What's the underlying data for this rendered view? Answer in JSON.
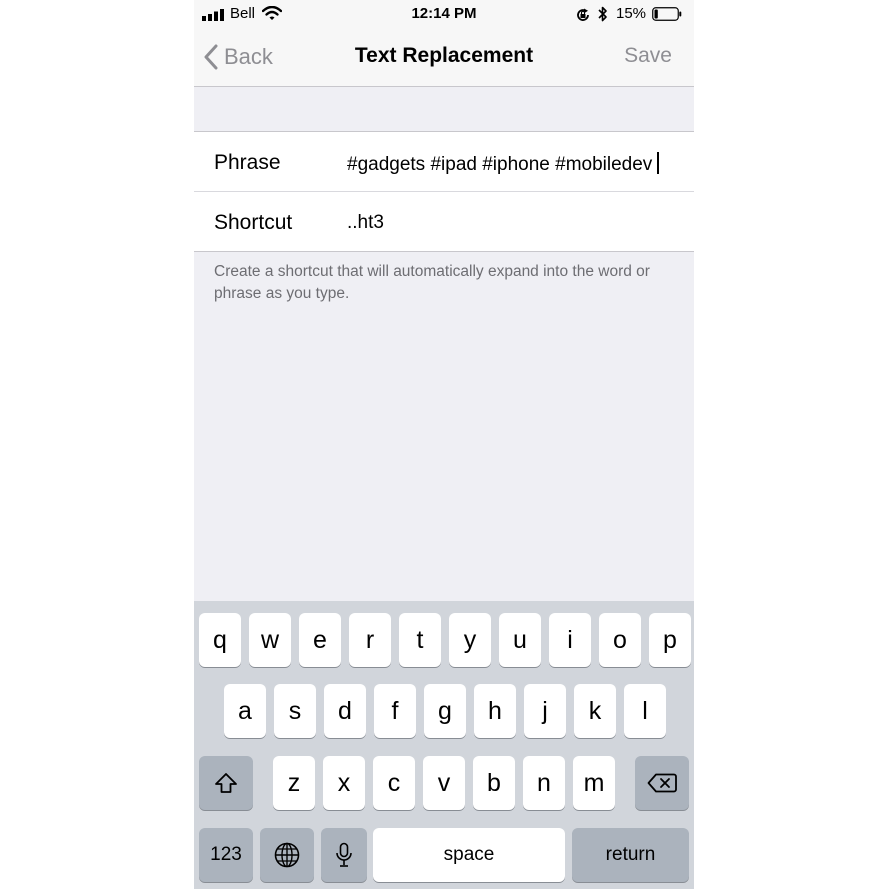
{
  "status_bar": {
    "carrier": "Bell",
    "time": "12:14 PM",
    "battery_percent": "15%",
    "battery_level": 0.15,
    "icons": [
      "signal-bars-icon",
      "wifi-icon",
      "orientation-lock-icon",
      "bluetooth-icon",
      "battery-icon"
    ]
  },
  "nav": {
    "back_label": "Back",
    "title": "Text Replacement",
    "save_label": "Save"
  },
  "form": {
    "phrase_label": "Phrase",
    "phrase_value": "#gadgets #ipad #iphone #mobiledev",
    "shortcut_label": "Shortcut",
    "shortcut_value": "..ht3",
    "footer": "Create a shortcut that will automatically expand into the word or phrase as you type."
  },
  "keyboard": {
    "row1": [
      "q",
      "w",
      "e",
      "r",
      "t",
      "y",
      "u",
      "i",
      "o",
      "p"
    ],
    "row2": [
      "a",
      "s",
      "d",
      "f",
      "g",
      "h",
      "j",
      "k",
      "l"
    ],
    "row3": [
      "z",
      "x",
      "c",
      "v",
      "b",
      "n",
      "m"
    ],
    "numbers_label": "123",
    "space_label": "space",
    "return_label": "return",
    "icons": [
      "shift-icon",
      "delete-icon",
      "globe-icon",
      "microphone-icon"
    ]
  },
  "colors": {
    "background": "#efeff4",
    "keyboard_bg": "#d1d5db",
    "inactive_button": "#8e8e93"
  }
}
